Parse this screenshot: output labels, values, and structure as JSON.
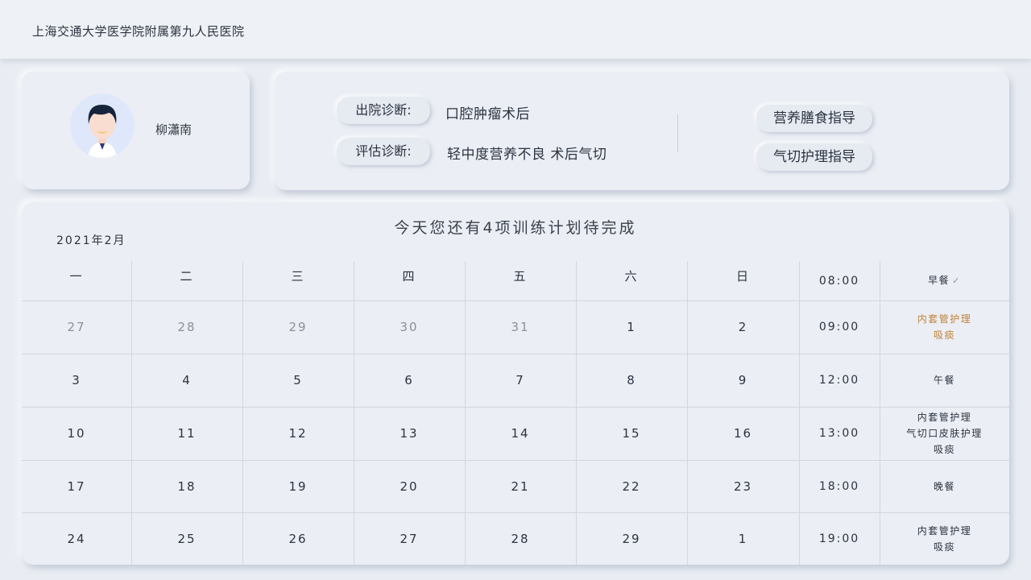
{
  "header": {
    "hospital": "上海交通大学医学院附属第九人民医院"
  },
  "patient": {
    "name": "柳瀟南"
  },
  "diagnosis": {
    "discharge_label": "出院诊断:",
    "discharge_value": "口腔肿瘤术后",
    "assessment_label": "评估诊断:",
    "assessment_value": "轻中度营养不良 术后气切"
  },
  "guides": {
    "nutrition": "营养膳食指导",
    "tracheotomy": "气切护理指导"
  },
  "calendar": {
    "title": "今天您还有4项训练计划待完成",
    "month": "2021年2月",
    "weekdays": [
      "一",
      "二",
      "三",
      "四",
      "五",
      "六",
      "日"
    ],
    "weeks": [
      [
        "27",
        "28",
        "29",
        "30",
        "31",
        "1",
        "2"
      ],
      [
        "3",
        "4",
        "5",
        "6",
        "7",
        "8",
        "9"
      ],
      [
        "10",
        "11",
        "12",
        "13",
        "14",
        "15",
        "16"
      ],
      [
        "17",
        "18",
        "19",
        "20",
        "21",
        "22",
        "23"
      ],
      [
        "24",
        "25",
        "26",
        "27",
        "28",
        "29",
        "1"
      ]
    ]
  },
  "schedule": [
    {
      "time": "08:00",
      "items": [
        "早餐"
      ],
      "done": true
    },
    {
      "time": "09:00",
      "items": [
        "内套管护理",
        "吸痰"
      ],
      "highlight": true
    },
    {
      "time": "12:00",
      "items": [
        "午餐"
      ]
    },
    {
      "time": "13:00",
      "items": [
        "内套管护理",
        "气切口皮肤护理",
        "吸痰"
      ]
    },
    {
      "time": "18:00",
      "items": [
        "晚餐"
      ]
    },
    {
      "time": "19:00",
      "items": [
        "内套管护理",
        "吸痰"
      ]
    }
  ],
  "colors": {
    "accent_orange": "#c08238",
    "background": "#e9edf3",
    "muted_text": "#8a919c"
  },
  "icons": {
    "check": "check-icon",
    "avatar": "doctor-avatar"
  }
}
